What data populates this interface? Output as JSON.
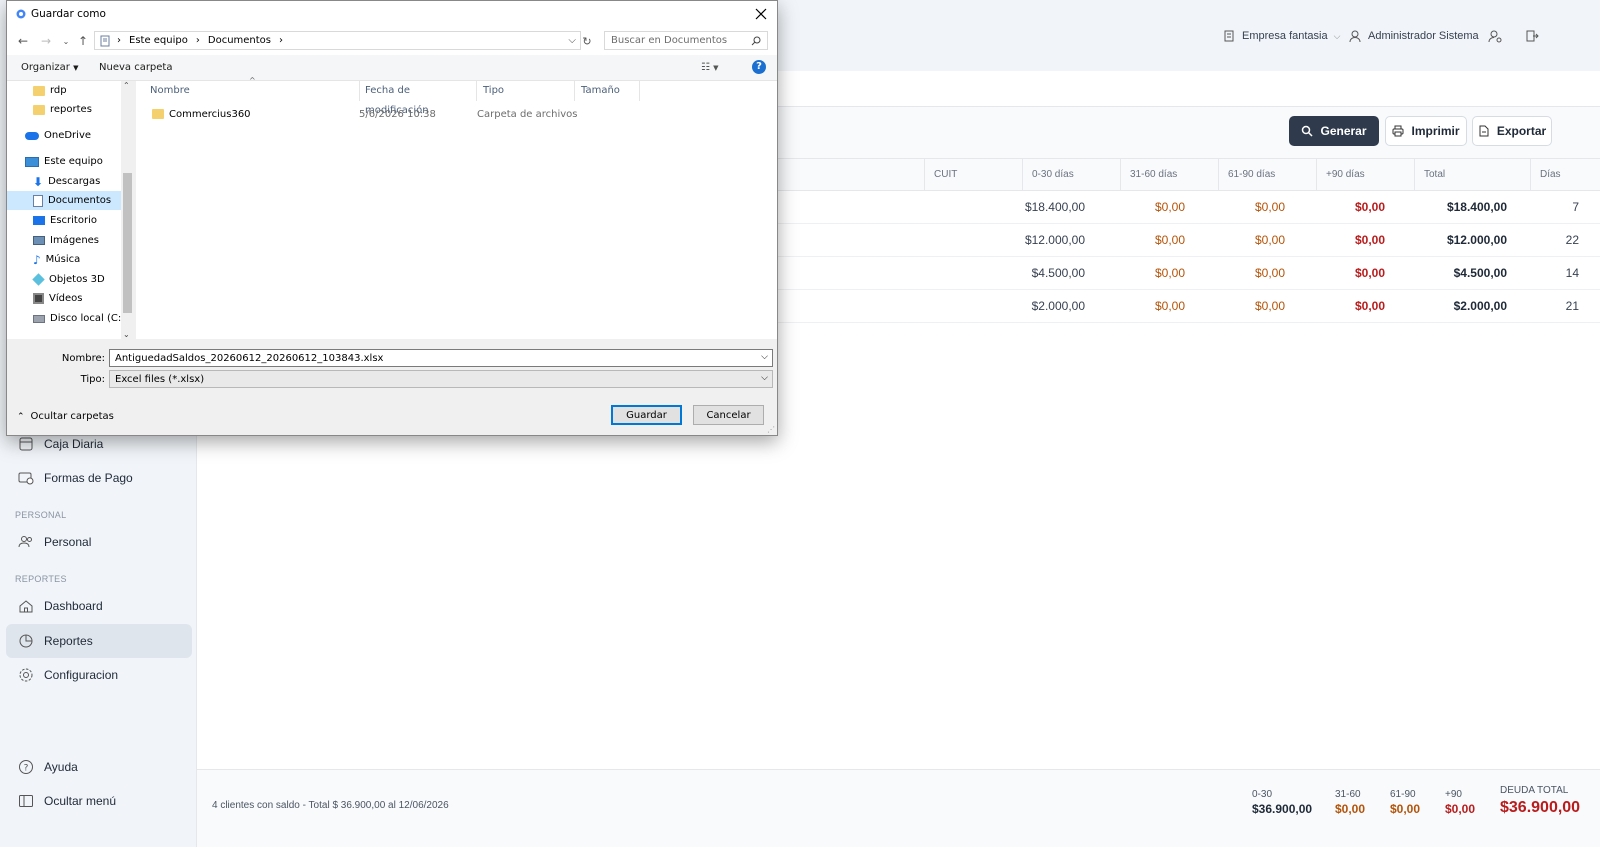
{
  "topbar": {
    "company": "Empresa fantasia",
    "user": "Administrador Sistema"
  },
  "sidebar": {
    "items": [
      {
        "label": "Caja Diaria"
      },
      {
        "label": "Formas de Pago"
      },
      {
        "label": "Personal"
      },
      {
        "label": "Dashboard"
      },
      {
        "label": "Reportes"
      },
      {
        "label": "Configuracion"
      },
      {
        "label": "Ayuda"
      },
      {
        "label": "Ocultar menú"
      }
    ],
    "sections": {
      "personal": "PERSONAL",
      "reportes": "REPORTES"
    }
  },
  "actions": {
    "generar": "Generar",
    "imprimir": "Imprimir",
    "exportar": "Exportar"
  },
  "table": {
    "headers": [
      "CUIT",
      "0-30 días",
      "31-60 días",
      "61-90 días",
      "+90 días",
      "Total",
      "Días"
    ],
    "rows": [
      {
        "d0": "$18.400,00",
        "d31": "$0,00",
        "d61": "$0,00",
        "d90": "$0,00",
        "total": "$18.400,00",
        "dias": "7"
      },
      {
        "d0": "$12.000,00",
        "d31": "$0,00",
        "d61": "$0,00",
        "d90": "$0,00",
        "total": "$12.000,00",
        "dias": "22"
      },
      {
        "d0": "$4.500,00",
        "d31": "$0,00",
        "d61": "$0,00",
        "d90": "$0,00",
        "total": "$4.500,00",
        "dias": "14"
      },
      {
        "d0": "$2.000,00",
        "d31": "$0,00",
        "d61": "$0,00",
        "d90": "$0,00",
        "total": "$2.000,00",
        "dias": "21"
      }
    ]
  },
  "footer": {
    "summary": "4 clientes con saldo - Total $ 36.900,00 al 12/06/2026",
    "b030_label": "0-30",
    "b030_value": "$36.900,00",
    "b3160_label": "31-60",
    "b3160_value": "$0,00",
    "b6190_label": "61-90",
    "b6190_value": "$0,00",
    "b90_label": "+90",
    "b90_value": "$0,00",
    "deuda_label": "DEUDA TOTAL",
    "deuda_value": "$36.900,00"
  },
  "dialog": {
    "title": "Guardar como",
    "path": [
      "Este equipo",
      "Documentos"
    ],
    "search_placeholder": "Buscar en Documentos",
    "organize": "Organizar",
    "new_folder": "Nueva carpeta",
    "tree": [
      {
        "label": "rdp"
      },
      {
        "label": "reportes"
      },
      {
        "label": "OneDrive"
      },
      {
        "label": "Este equipo"
      },
      {
        "label": "Descargas"
      },
      {
        "label": "Documentos"
      },
      {
        "label": "Escritorio"
      },
      {
        "label": "Imágenes"
      },
      {
        "label": "Música"
      },
      {
        "label": "Objetos 3D"
      },
      {
        "label": "Vídeos"
      },
      {
        "label": "Disco local (C:)"
      }
    ],
    "columns": [
      "Nombre",
      "Fecha de modificación",
      "Tipo",
      "Tamaño"
    ],
    "files": [
      {
        "name": "Commercius360",
        "date": "5/6/2026 10:38",
        "type": "Carpeta de archivos"
      }
    ],
    "name_label": "Nombre:",
    "filename": "AntiguedadSaldos_20260612_20260612_103843.xlsx",
    "type_label": "Tipo:",
    "filetype": "Excel files (*.xlsx)",
    "hide_folders": "Ocultar carpetas",
    "save": "Guardar",
    "cancel": "Cancelar"
  },
  "colors": {
    "primary_button": "#2f3b4c",
    "amount_orange": "#b45309",
    "amount_red": "#b91c1c",
    "dialog_accent": "#0078d7"
  }
}
